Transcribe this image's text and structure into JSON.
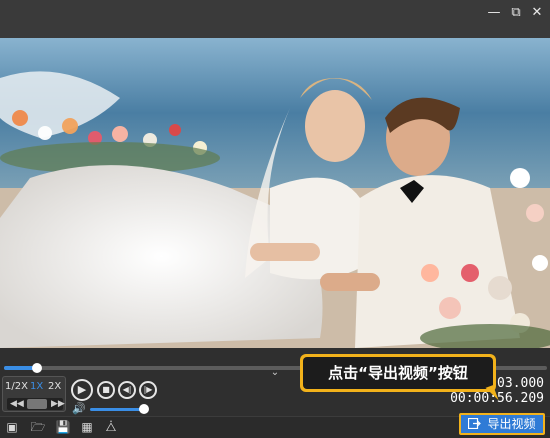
{
  "window": {
    "minimize_icon": "minimize-icon",
    "restore_icon": "restore-icon",
    "close_icon": "close-icon"
  },
  "preview": {
    "description_icon": "video-frame"
  },
  "speed": {
    "options": [
      "1/2X",
      "1X",
      "2X"
    ],
    "selected": "1X"
  },
  "playback": {
    "progress": 0.06,
    "volume": 1.0
  },
  "time": {
    "current": "00:00:03.000",
    "total": "00:00:56.209"
  },
  "callout": {
    "text": "点击“导出视频”按钮"
  },
  "toolbar": {
    "export_label": "导出视频"
  },
  "colors": {
    "accent": "#2f7bd6",
    "highlight": "#f2b21b"
  }
}
